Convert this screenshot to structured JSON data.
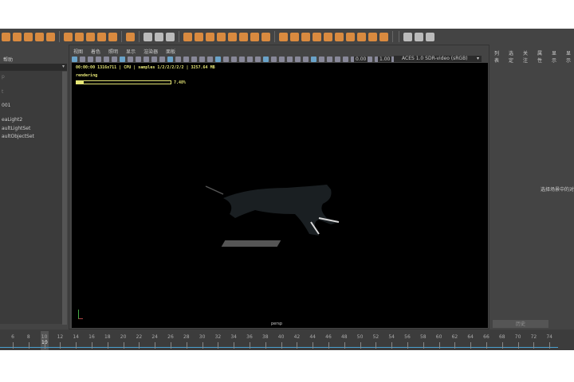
{
  "left_panel": {
    "menu": "帮助",
    "items": [
      "p",
      "t",
      "001",
      "eaLight2",
      "aultLightSet",
      "aultObjectSet"
    ]
  },
  "viewport": {
    "menu": [
      "视图",
      "着色",
      "照明",
      "显示",
      "渲染器",
      "面板"
    ],
    "exposure": "0.00",
    "gamma": "1.00",
    "color_space": "ACES 1.0 SDR-video (sRGB)",
    "hud_line1": "00:00:00 1316x711 | CPU | samples 1/2/2/2/2/2 | 3257.64 MB",
    "hud_status": "rendering",
    "progress_percent": 7.48,
    "progress_label": "7.48%",
    "camera": "persp"
  },
  "right_panel": {
    "tabs": [
      "列表",
      "选定",
      "关注",
      "属性",
      "显示",
      "显示"
    ],
    "hint": "选择场景中的对象",
    "bottom_tab": "历史"
  },
  "timeline": {
    "ticks": [
      "6",
      "8",
      "10",
      "12",
      "14",
      "16",
      "18",
      "20",
      "22",
      "24",
      "26",
      "28",
      "30",
      "32",
      "34",
      "36",
      "38",
      "40",
      "42",
      "44",
      "46",
      "48",
      "50",
      "52",
      "54",
      "56",
      "58",
      "60",
      "62",
      "64",
      "66",
      "68",
      "70",
      "72",
      "74"
    ],
    "current_frame": "10"
  }
}
